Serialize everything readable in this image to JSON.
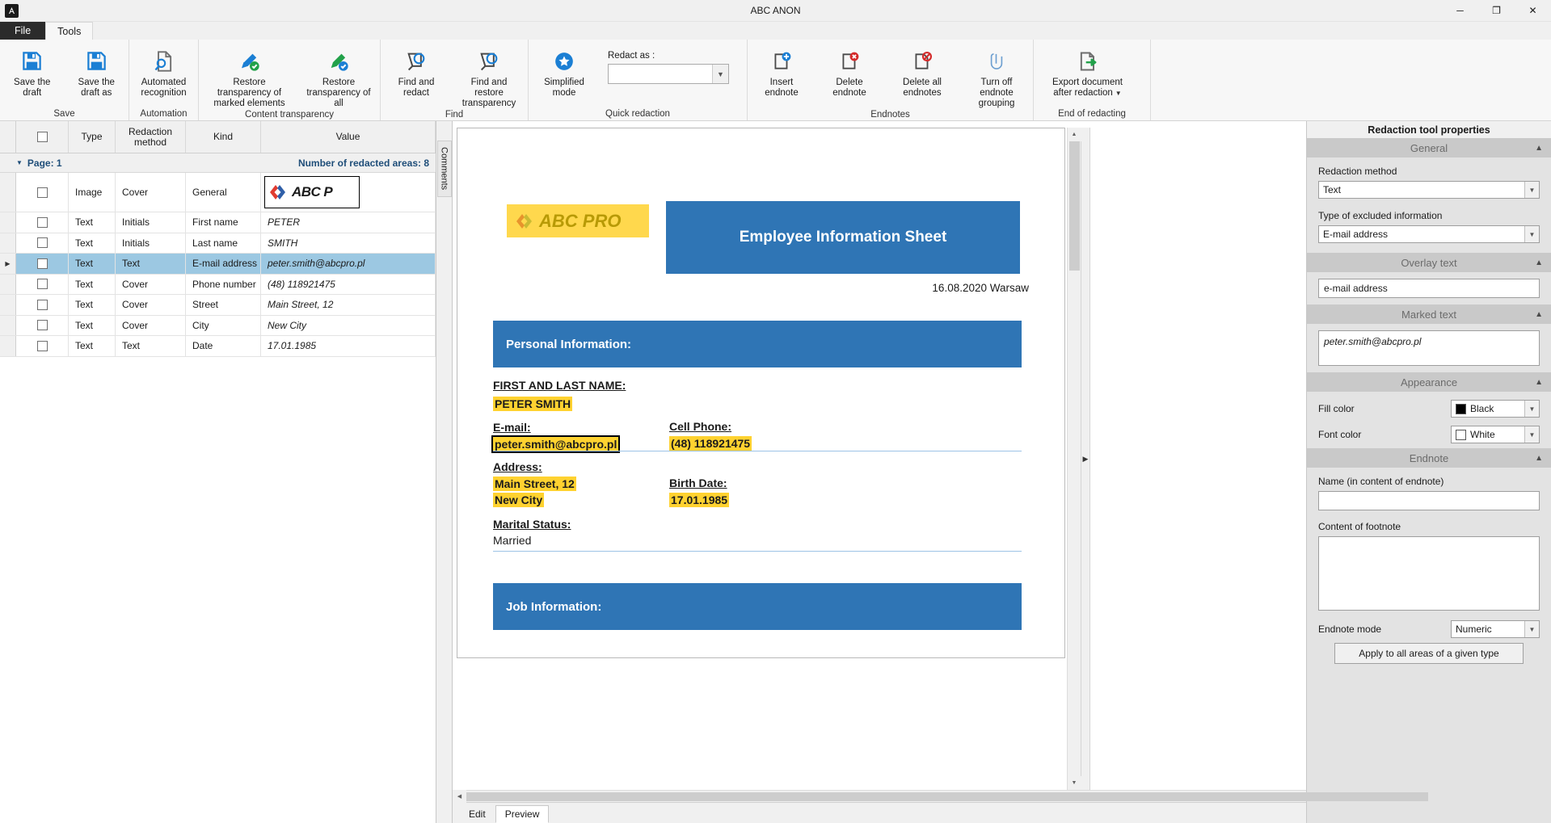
{
  "window": {
    "title": "ABC ANON",
    "app_icon": "app-icon",
    "minimize": "─",
    "maximize": "❐",
    "close": "✕"
  },
  "ribbon": {
    "tabs": [
      {
        "label": "File",
        "active": false
      },
      {
        "label": "Tools",
        "active": true
      }
    ],
    "groups": [
      {
        "title": "Save",
        "items": [
          {
            "label": "Save the draft",
            "icon": "save-disk-icon"
          },
          {
            "label": "Save the draft as",
            "icon": "save-as-disk-icon"
          }
        ]
      },
      {
        "title": "Automation",
        "items": [
          {
            "label": "Automated recognition",
            "icon": "document-magnifier-icon"
          }
        ]
      },
      {
        "title": "Content transparency",
        "items": [
          {
            "label": "Restore transparency of marked elements",
            "icon": "marker-check-blue-icon"
          },
          {
            "label": "Restore transparency of all",
            "icon": "marker-check-green-icon"
          }
        ]
      },
      {
        "title": "Find",
        "items": [
          {
            "label": "Find and redact",
            "icon": "find-redact-icon"
          },
          {
            "label": "Find and restore transparency",
            "icon": "find-restore-icon"
          }
        ]
      },
      {
        "title": "Quick redaction",
        "items": [
          {
            "label": "Simplified mode",
            "icon": "star-circle-icon"
          }
        ],
        "field": {
          "label": "Redact as :",
          "value": "",
          "placeholder": ""
        }
      },
      {
        "title": "Endnotes",
        "items": [
          {
            "label": "Insert endnote",
            "icon": "page-plus-icon"
          },
          {
            "label": "Delete endnote",
            "icon": "page-delete-icon"
          },
          {
            "label": "Delete all endnotes",
            "icon": "page-ban-icon"
          },
          {
            "label": "Turn off endnote grouping",
            "icon": "paperclip-icon"
          }
        ]
      },
      {
        "title": "End of redacting",
        "items": [
          {
            "label": "Export document after redaction",
            "icon": "page-export-arrow-icon",
            "has_dropdown": true
          }
        ]
      }
    ]
  },
  "grid": {
    "columns": [
      "",
      "Type",
      "Redaction method",
      "Kind",
      "Value"
    ],
    "group_label": "Page: 1",
    "group_count_label": "Number of redacted areas: 8",
    "rows": [
      {
        "type": "Image",
        "method": "Cover",
        "kind": "General",
        "value": "ABC PRO",
        "is_logo": true,
        "selected": false
      },
      {
        "type": "Text",
        "method": "Initials",
        "kind": "First name",
        "value": "PETER",
        "selected": false
      },
      {
        "type": "Text",
        "method": "Initials",
        "kind": "Last name",
        "value": "SMITH",
        "selected": false
      },
      {
        "type": "Text",
        "method": "Text",
        "kind": "E-mail address",
        "value": "peter.smith@abcpro.pl",
        "selected": true
      },
      {
        "type": "Text",
        "method": "Cover",
        "kind": "Phone number",
        "value": "(48) 118921475",
        "selected": false
      },
      {
        "type": "Text",
        "method": "Cover",
        "kind": "Street",
        "value": "Main Street, 12",
        "selected": false
      },
      {
        "type": "Text",
        "method": "Cover",
        "kind": "City",
        "value": "New City",
        "selected": false
      },
      {
        "type": "Text",
        "method": "Text",
        "kind": "Date",
        "value": "17.01.1985",
        "selected": false
      }
    ]
  },
  "comments_tab": "Comments",
  "document": {
    "logo_text": "ABC PRO",
    "title": "Employee Information Sheet",
    "date_line": "16.08.2020 Warsaw",
    "sections": [
      {
        "heading": "Personal Information:"
      },
      {
        "heading": "Job Information:"
      }
    ],
    "fields": {
      "name_label": "FIRST AND LAST NAME:",
      "name_value": "PETER SMITH",
      "email_label": "E-mail:",
      "email_value": "peter.smith@abcpro.pl",
      "phone_label": "Cell Phone:",
      "phone_value": "(48) 118921475",
      "address_label": "Address:",
      "address_line1": "Main Street, 12",
      "address_line2": "New City",
      "birth_label": "Birth Date:",
      "birth_value": "17.01.1985",
      "marital_label": "Marital Status:",
      "marital_value": "Married"
    }
  },
  "bottom_tabs": [
    {
      "label": "Edit",
      "active": false
    },
    {
      "label": "Preview",
      "active": true
    }
  ],
  "properties": {
    "title": "Redaction tool properties",
    "general": {
      "heading": "General",
      "method_label": "Redaction method",
      "method_value": "Text",
      "excluded_label": "Type of excluded information",
      "excluded_value": "E-mail address"
    },
    "overlay": {
      "heading": "Overlay text",
      "value": "e-mail address"
    },
    "marked": {
      "heading": "Marked text",
      "value": "peter.smith@abcpro.pl"
    },
    "appearance": {
      "heading": "Appearance",
      "fill_label": "Fill color",
      "fill_value": "Black",
      "fill_hex": "#000000",
      "font_label": "Font color",
      "font_value": "White",
      "font_hex": "#ffffff"
    },
    "endnote": {
      "heading": "Endnote",
      "name_label": "Name (in content of endnote)",
      "name_value": "",
      "content_label": "Content of footnote",
      "content_value": "",
      "mode_label": "Endnote mode",
      "mode_value": "Numeric",
      "apply_button": "Apply to all areas of a given type"
    }
  },
  "colors": {
    "accent_blue": "#2f75b5",
    "highlight_yellow": "#ffd230",
    "selection_blue": "#9cc8e2",
    "link_blue": "#1f4e79"
  }
}
